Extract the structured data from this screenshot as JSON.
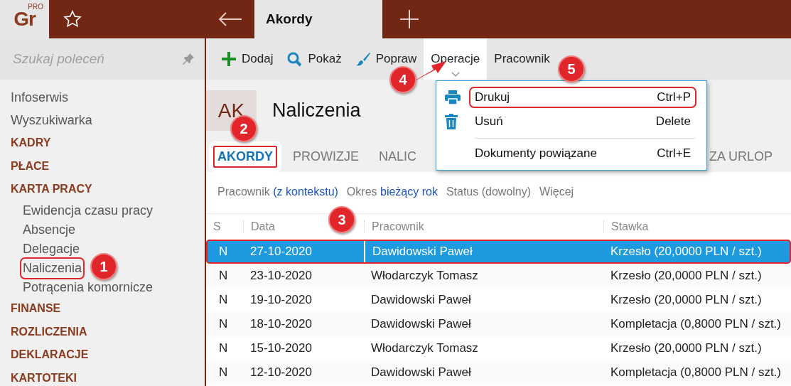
{
  "topbar": {
    "logo": "Gr",
    "logo_badge": "PRO",
    "tab": {
      "label": "Akordy",
      "selected": true
    }
  },
  "sidebar": {
    "search": {
      "placeholder": "Szukaj poleceń"
    },
    "items": [
      {
        "label": "Infoserwis",
        "kind": "link"
      },
      {
        "label": "Wyszukiwarka",
        "kind": "link"
      },
      {
        "label": "KADRY",
        "kind": "section"
      },
      {
        "label": "PŁACE",
        "kind": "section"
      },
      {
        "label": "KARTA PRACY",
        "kind": "section",
        "children": [
          {
            "label": "Ewidencja czasu pracy",
            "highlighted": false
          },
          {
            "label": "Absencje",
            "highlighted": false
          },
          {
            "label": "Delegacje",
            "highlighted": false
          },
          {
            "label": "Naliczenia",
            "highlighted": true
          },
          {
            "label": "Potrącenia komornicze",
            "highlighted": false
          }
        ]
      },
      {
        "label": "FINANSE",
        "kind": "section"
      },
      {
        "label": "ROZLICZENIA",
        "kind": "section"
      },
      {
        "label": "DEKLARACJE",
        "kind": "section"
      },
      {
        "label": "KARTOTEKI",
        "kind": "section"
      }
    ]
  },
  "toolbar": [
    {
      "label": "Dodaj",
      "kind": "add",
      "open": false
    },
    {
      "label": "Pokaż",
      "kind": "show",
      "open": false
    },
    {
      "label": "Popraw",
      "kind": "edit",
      "open": false
    },
    {
      "label": "Operacje",
      "kind": "menu",
      "open": true
    },
    {
      "label": "Pracownik",
      "kind": "plain",
      "open": false
    }
  ],
  "header": {
    "badge": "AK",
    "title": "Naliczenia"
  },
  "tabs": [
    {
      "label": "AKORDY",
      "selected": true,
      "highlighted": true
    },
    {
      "label": "PROWIZJE",
      "selected": false,
      "highlighted": false
    },
    {
      "label": "NALIC",
      "selected": false,
      "highlighted": false
    },
    {
      "label": "ZA URLOP",
      "selected": false,
      "highlighted": false
    }
  ],
  "filters": [
    {
      "label": "Pracownik",
      "value": "(z kontekstu)"
    },
    {
      "label": "Okres",
      "value": "bieżący rok"
    },
    {
      "label": "Status (dowolny)"
    },
    {
      "label": "Więcej"
    }
  ],
  "table": {
    "columns": [
      "S",
      "Data",
      "Pracownik",
      "Stawka"
    ],
    "rows": [
      {
        "cells": [
          "N",
          "27-10-2020",
          "Dawidowski Paweł",
          "Krzesło (20,0000 PLN / szt.)"
        ],
        "selected": true,
        "highlighted": true
      },
      {
        "cells": [
          "N",
          "23-10-2020",
          "Włodarczyk Tomasz",
          "Krzesło (20,0000 PLN / szt.)"
        ],
        "selected": false,
        "highlighted": false
      },
      {
        "cells": [
          "N",
          "19-10-2020",
          "Dawidowski Paweł",
          "Krzesło (20,0000 PLN / szt.)"
        ],
        "selected": false,
        "highlighted": false
      },
      {
        "cells": [
          "N",
          "18-10-2020",
          "Dawidowski Paweł",
          "Kompletacja (0,8000 PLN / szt.)"
        ],
        "selected": false,
        "highlighted": false
      },
      {
        "cells": [
          "N",
          "15-10-2020",
          "Włodarczyk Tomasz",
          "Krzesło (20,0000 PLN / szt.)"
        ],
        "selected": false,
        "highlighted": false
      },
      {
        "cells": [
          "N",
          "12-10-2020",
          "Dawidowski Paweł",
          "Kompletacja (0,8000 PLN / szt.)"
        ],
        "selected": false,
        "highlighted": false
      }
    ]
  },
  "menu": {
    "items": [
      {
        "label": "Drukuj",
        "shortcut": "Ctrl+P",
        "kind": "print",
        "highlighted": true,
        "separator_before": false
      },
      {
        "label": "Usuń",
        "shortcut": "Delete",
        "kind": "delete",
        "highlighted": false,
        "separator_before": false
      },
      {
        "label": "Dokumenty powiązane",
        "shortcut": "Ctrl+E",
        "kind": "none",
        "highlighted": false,
        "separator_before": true
      }
    ]
  },
  "callouts": [
    "1",
    "2",
    "3",
    "4",
    "5"
  ]
}
